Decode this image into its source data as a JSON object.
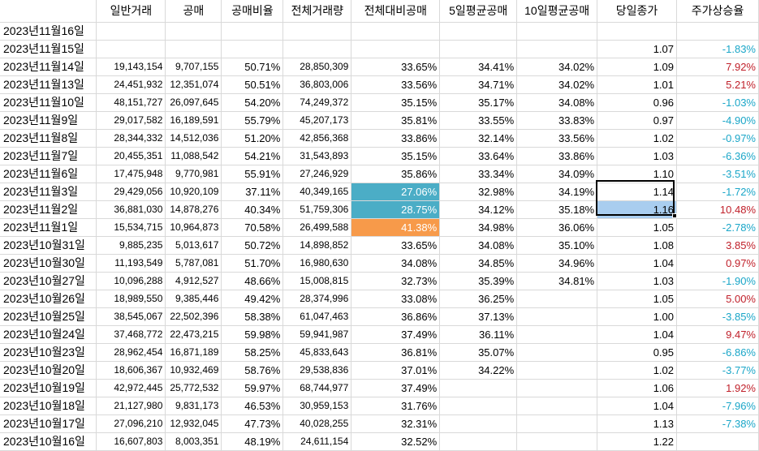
{
  "headers": [
    "",
    "일반거래",
    "공매",
    "공매비율",
    "전체거래량",
    "전체대비공매",
    "5일평균공매",
    "10일평균공매",
    "당일종가",
    "주가상승율"
  ],
  "rows": [
    [
      "2023년11월16일",
      "",
      "",
      "",
      "",
      "",
      "",
      "",
      "",
      ""
    ],
    [
      "2023년11월15일",
      "",
      "",
      "",
      "",
      "",
      "",
      "",
      "1.07",
      "-1.83%"
    ],
    [
      "2023년11월14일",
      "19,143,154",
      "9,707,155",
      "50.71%",
      "28,850,309",
      "33.65%",
      "34.41%",
      "34.02%",
      "1.09",
      "7.92%"
    ],
    [
      "2023년11월13일",
      "24,451,932",
      "12,351,074",
      "50.51%",
      "36,803,006",
      "33.56%",
      "34.71%",
      "34.02%",
      "1.01",
      "5.21%"
    ],
    [
      "2023년11월10일",
      "48,151,727",
      "26,097,645",
      "54.20%",
      "74,249,372",
      "35.15%",
      "35.17%",
      "34.08%",
      "0.96",
      "-1.03%"
    ],
    [
      "2023년11월9일",
      "29,017,582",
      "16,189,591",
      "55.79%",
      "45,207,173",
      "35.81%",
      "33.55%",
      "33.83%",
      "0.97",
      "-4.90%"
    ],
    [
      "2023년11월8일",
      "28,344,332",
      "14,512,036",
      "51.20%",
      "42,856,368",
      "33.86%",
      "32.14%",
      "33.56%",
      "1.02",
      "-0.97%"
    ],
    [
      "2023년11월7일",
      "20,455,351",
      "11,088,542",
      "54.21%",
      "31,543,893",
      "35.15%",
      "33.64%",
      "33.86%",
      "1.03",
      "-6.36%"
    ],
    [
      "2023년11월6일",
      "17,475,948",
      "9,770,981",
      "55.91%",
      "27,246,929",
      "35.86%",
      "33.34%",
      "34.09%",
      "1.10",
      "-3.51%"
    ],
    [
      "2023년11월3일",
      "29,429,056",
      "10,920,109",
      "37.11%",
      "40,349,165",
      "27.06%",
      "32.98%",
      "34.19%",
      "1.14",
      "-1.72%"
    ],
    [
      "2023년11월2일",
      "36,881,030",
      "14,878,276",
      "40.34%",
      "51,759,306",
      "28.75%",
      "34.12%",
      "35.18%",
      "1.16",
      "10.48%"
    ],
    [
      "2023년11월1일",
      "15,534,715",
      "10,964,873",
      "70.58%",
      "26,499,588",
      "41.38%",
      "34.98%",
      "36.06%",
      "1.05",
      "-2.78%"
    ],
    [
      "2023년10월31일",
      "9,885,235",
      "5,013,617",
      "50.72%",
      "14,898,852",
      "33.65%",
      "34.08%",
      "35.10%",
      "1.08",
      "3.85%"
    ],
    [
      "2023년10월30일",
      "11,193,549",
      "5,787,081",
      "51.70%",
      "16,980,630",
      "34.08%",
      "34.85%",
      "34.96%",
      "1.04",
      "0.97%"
    ],
    [
      "2023년10월27일",
      "10,096,288",
      "4,912,527",
      "48.66%",
      "15,008,815",
      "32.73%",
      "35.39%",
      "34.81%",
      "1.03",
      "-1.90%"
    ],
    [
      "2023년10월26일",
      "18,989,550",
      "9,385,446",
      "49.42%",
      "28,374,996",
      "33.08%",
      "36.25%",
      "",
      "1.05",
      "5.00%"
    ],
    [
      "2023년10월25일",
      "38,545,067",
      "22,502,396",
      "58.38%",
      "61,047,463",
      "36.86%",
      "37.13%",
      "",
      "1.00",
      "-3.85%"
    ],
    [
      "2023년10월24일",
      "37,468,772",
      "22,473,215",
      "59.98%",
      "59,941,987",
      "37.49%",
      "36.11%",
      "",
      "1.04",
      "9.47%"
    ],
    [
      "2023년10월23일",
      "28,962,454",
      "16,871,189",
      "58.25%",
      "45,833,643",
      "36.81%",
      "35.07%",
      "",
      "0.95",
      "-6.86%"
    ],
    [
      "2023년10월20일",
      "18,606,367",
      "10,932,469",
      "58.76%",
      "29,538,836",
      "37.01%",
      "34.22%",
      "",
      "1.02",
      "-3.77%"
    ],
    [
      "2023년10월19일",
      "42,972,445",
      "25,772,532",
      "59.97%",
      "68,744,977",
      "37.49%",
      "",
      "",
      "1.06",
      "1.92%"
    ],
    [
      "2023년10월18일",
      "21,127,980",
      "9,831,173",
      "46.53%",
      "30,959,153",
      "31.76%",
      "",
      "",
      "1.04",
      "-7.96%"
    ],
    [
      "2023년10월17일",
      "27,096,210",
      "12,932,045",
      "47.73%",
      "40,028,255",
      "32.31%",
      "",
      "",
      "1.13",
      "-7.38%"
    ],
    [
      "2023년10월16일",
      "16,607,803",
      "8,003,351",
      "48.19%",
      "24,611,154",
      "32.52%",
      "",
      "",
      "1.22",
      ""
    ]
  ],
  "colors": {
    "highlight_teal": "#4badc6",
    "highlight_orange": "#f79a4a",
    "selected_cell": "#a9cdef",
    "positive_change": "#c0202a",
    "negative_change": "#1aa6c8"
  }
}
